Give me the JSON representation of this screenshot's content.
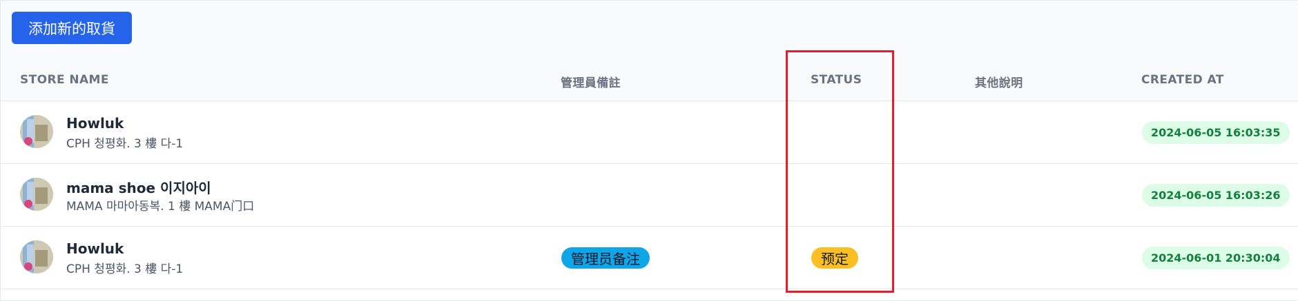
{
  "toolbar": {
    "add_pickup_label": "添加新的取貨"
  },
  "table": {
    "columns": {
      "store_name": "STORE NAME",
      "admin_note": "管理員備註",
      "status": "STATUS",
      "other_notes": "其他說明",
      "created_at": "CREATED AT"
    },
    "rows": [
      {
        "store_name": "Howluk",
        "address": "CPH 청평화. 3 樓 다-1",
        "admin_note": "",
        "status": "",
        "other_notes": "",
        "created_at": "2024-06-05 16:03:35"
      },
      {
        "store_name": "mama shoe 이지아이",
        "address": "MAMA 마마아동복. 1 樓 MAMA门口",
        "admin_note": "",
        "status": "",
        "other_notes": "",
        "created_at": "2024-06-05 16:03:26"
      },
      {
        "store_name": "Howluk",
        "address": "CPH 청평화. 3 樓 다-1",
        "admin_note": "管理员备注",
        "status": "预定",
        "other_notes": "",
        "created_at": "2024-06-01 20:30:04"
      }
    ]
  },
  "colors": {
    "primary_button": "#2563eb",
    "date_badge_bg": "#dcfce7",
    "date_badge_text": "#15803d",
    "note_badge_bg": "#0ea5e9",
    "status_badge_bg": "#fbbf24",
    "highlight_box": "#e11d2e"
  }
}
